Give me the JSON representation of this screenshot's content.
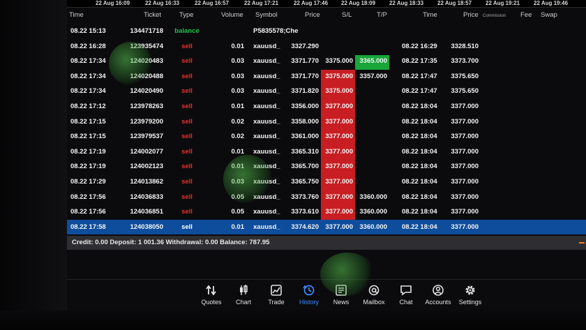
{
  "timescale": [
    "22 Aug 16:09",
    "22 Aug 16:33",
    "22 Aug 16:57",
    "22 Aug 17:21",
    "22 Aug 17:46",
    "22 Aug 18:09",
    "22 Aug 18:33",
    "22 Aug 18:57",
    "22 Aug 19:21",
    "22 Aug 19:46"
  ],
  "columns": {
    "time": "Time",
    "ticket": "Ticket",
    "type": "Type",
    "volume": "Volume",
    "symbol": "Symbol",
    "price": "Price",
    "sl": "S/L",
    "tp": "T/P",
    "close_time": "Time",
    "close_price": "Price",
    "commission": "Commission",
    "fee": "Fee",
    "swap": "Swap"
  },
  "rows": [
    {
      "time": "08.22 15:13",
      "ticket": "134471718",
      "type": "balance",
      "volume": "",
      "symbol": "P5835578;Che",
      "price": "",
      "sl": "",
      "tp": "",
      "close_time": "",
      "close_price": ""
    },
    {
      "time": "08.22 16:28",
      "ticket": "123935474",
      "type": "sell",
      "volume": "0.01",
      "symbol": "xauusd_",
      "price": "3327.290",
      "sl": "",
      "tp": "",
      "close_time": "08.22 16:29",
      "close_price": "3328.510"
    },
    {
      "time": "08.22 17:34",
      "ticket": "124020483",
      "type": "sell",
      "volume": "0.03",
      "symbol": "xauusd_",
      "price": "3371.770",
      "sl": "3375.000",
      "tp": "3365.000",
      "close_time": "08.22 17:35",
      "close_price": "3373.700"
    },
    {
      "time": "08.22 17:34",
      "ticket": "124020488",
      "type": "sell",
      "volume": "0.03",
      "symbol": "xauusd_",
      "price": "3371.770",
      "sl": "3375.000",
      "tp": "3357.000",
      "close_time": "08.22 17:47",
      "close_price": "3375.650"
    },
    {
      "time": "08.22 17:34",
      "ticket": "124020490",
      "type": "sell",
      "volume": "0.03",
      "symbol": "xauusd_",
      "price": "3371.820",
      "sl": "3375.000",
      "tp": "",
      "close_time": "08.22 17:47",
      "close_price": "3375.650"
    },
    {
      "time": "08.22 17:12",
      "ticket": "123978263",
      "type": "sell",
      "volume": "0.01",
      "symbol": "xauusd_",
      "price": "3356.000",
      "sl": "3377.000",
      "tp": "",
      "close_time": "08.22 18:04",
      "close_price": "3377.000"
    },
    {
      "time": "08.22 17:15",
      "ticket": "123979200",
      "type": "sell",
      "volume": "0.02",
      "symbol": "xauusd_",
      "price": "3358.000",
      "sl": "3377.000",
      "tp": "",
      "close_time": "08.22 18:04",
      "close_price": "3377.000"
    },
    {
      "time": "08.22 17:15",
      "ticket": "123979537",
      "type": "sell",
      "volume": "0.02",
      "symbol": "xauusd_",
      "price": "3361.000",
      "sl": "3377.000",
      "tp": "",
      "close_time": "08.22 18:04",
      "close_price": "3377.000"
    },
    {
      "time": "08.22 17:19",
      "ticket": "124002077",
      "type": "sell",
      "volume": "0.01",
      "symbol": "xauusd_",
      "price": "3365.310",
      "sl": "3377.000",
      "tp": "",
      "close_time": "08.22 18:04",
      "close_price": "3377.000"
    },
    {
      "time": "08.22 17:19",
      "ticket": "124002123",
      "type": "sell",
      "volume": "0.01",
      "symbol": "xauusd_",
      "price": "3365.700",
      "sl": "3377.000",
      "tp": "",
      "close_time": "08.22 18:04",
      "close_price": "3377.000"
    },
    {
      "time": "08.22 17:29",
      "ticket": "124013862",
      "type": "sell",
      "volume": "0.03",
      "symbol": "xauusd_",
      "price": "3365.750",
      "sl": "3377.000",
      "tp": "",
      "close_time": "08.22 18:04",
      "close_price": "3377.000"
    },
    {
      "time": "08.22 17:56",
      "ticket": "124036833",
      "type": "sell",
      "volume": "0.05",
      "symbol": "xauusd_",
      "price": "3373.760",
      "sl": "3377.000",
      "tp": "3360.000",
      "close_time": "08.22 18:04",
      "close_price": "3377.000"
    },
    {
      "time": "08.22 17:56",
      "ticket": "124036851",
      "type": "sell",
      "volume": "0.05",
      "symbol": "xauusd_",
      "price": "3373.610",
      "sl": "3377.000",
      "tp": "3360.000",
      "close_time": "08.22 18:04",
      "close_price": "3377.000"
    },
    {
      "time": "08.22 17:58",
      "ticket": "124038050",
      "type": "sell",
      "volume": "0.01",
      "symbol": "xauusd_",
      "price": "3374.620",
      "sl": "3377.000",
      "tp": "3360.000",
      "close_time": "08.22 18:04",
      "close_price": "3377.000"
    }
  ],
  "summary": "Credit: 0.00 Deposit: 1 001.36 Withdrawal: 0.00 Balance: 787.95",
  "tabs": [
    {
      "label": "Quotes",
      "icon": "quotes-icon"
    },
    {
      "label": "Chart",
      "icon": "chart-icon"
    },
    {
      "label": "Trade",
      "icon": "trade-icon"
    },
    {
      "label": "History",
      "icon": "history-icon"
    },
    {
      "label": "News",
      "icon": "news-icon"
    },
    {
      "label": "Mailbox",
      "icon": "mailbox-icon"
    },
    {
      "label": "Chat",
      "icon": "chat-icon"
    },
    {
      "label": "Accounts",
      "icon": "accounts-icon"
    },
    {
      "label": "Settings",
      "icon": "settings-icon"
    }
  ],
  "active_tab": "History",
  "colors": {
    "sell": "#e8302c",
    "balance": "#22c24a",
    "sl_fill": "#c81d22",
    "tp_fill": "#18a53a",
    "selected_row": "#0e4d9c",
    "active_tab": "#3b8cff"
  }
}
